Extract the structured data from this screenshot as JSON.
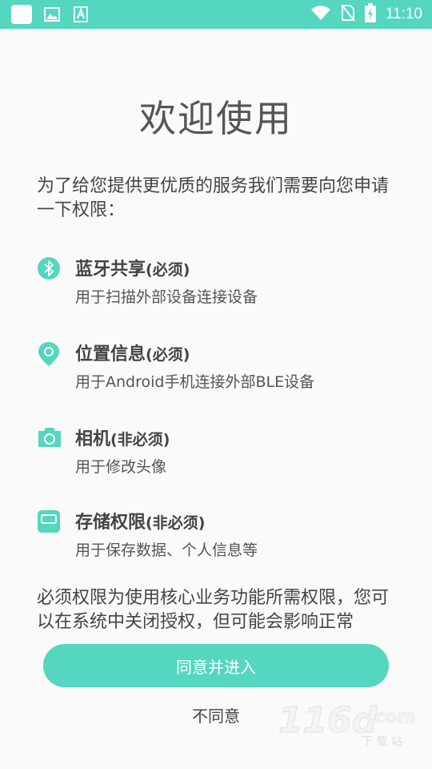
{
  "status_bar": {
    "time": "11:10",
    "left_icons": [
      "app-square-icon",
      "image-icon",
      "font-a-icon"
    ],
    "right_icons": [
      "wifi-icon",
      "no-sim-icon",
      "battery-charging-icon"
    ]
  },
  "title": "欢迎使用",
  "intro": "为了给您提供更优质的服务我们需要向您申请一下权限：",
  "permissions": [
    {
      "icon": "bluetooth-icon",
      "title": "蓝牙共享",
      "requirement": "(必须)",
      "desc": "用于扫描外部设备连接设备"
    },
    {
      "icon": "location-icon",
      "title": "位置信息",
      "requirement": "(必须)",
      "desc": "用于Android手机连接外部BLE设备"
    },
    {
      "icon": "camera-icon",
      "title": "相机",
      "requirement": "(非必须)",
      "desc": "用于修改头像"
    },
    {
      "icon": "storage-icon",
      "title": "存储权限",
      "requirement": "(非必须)",
      "desc": "用于保存数据、个人信息等"
    }
  ],
  "notice": "必须权限为使用核心业务功能所需权限，您可以在系统中关闭授权，但可能会影响正常",
  "buttons": {
    "agree": "同意并进入",
    "disagree": "不同意"
  },
  "watermark": {
    "brand": "116d.com",
    "sub": "下载站"
  },
  "colors": {
    "accent": "#55d6bf",
    "background": "#fafafa"
  }
}
